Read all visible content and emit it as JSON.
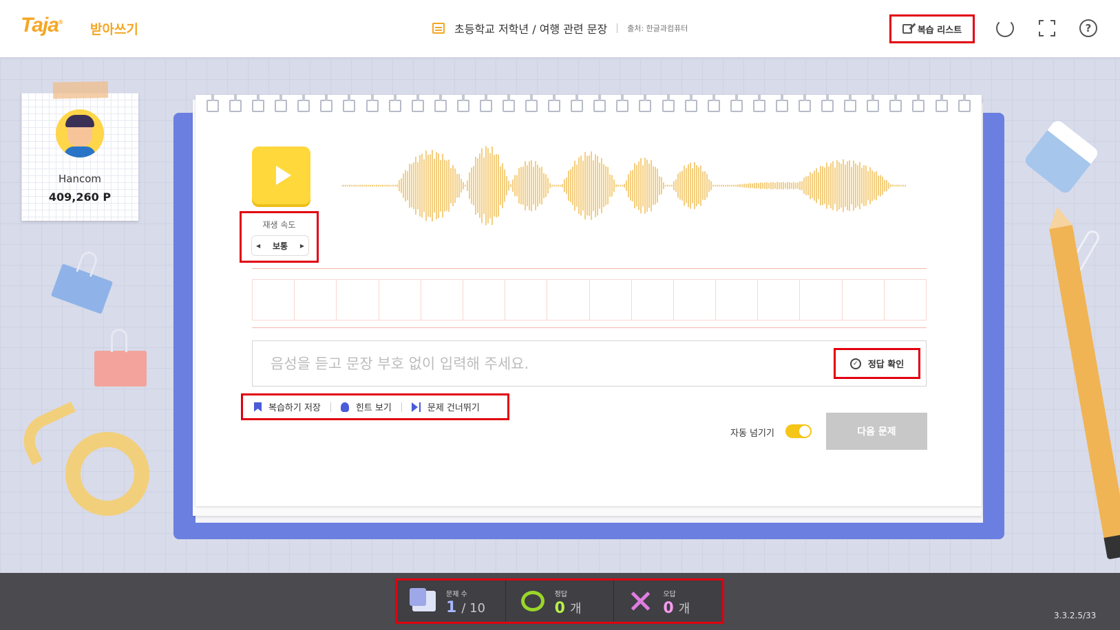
{
  "header": {
    "logo": "Taja",
    "mode_label": "받아쓰기",
    "title": "초등학교 저학년 / 여행 관련 문장",
    "source": "출처: 한글과컴퓨터",
    "review_list_label": "복습 리스트",
    "icons": [
      "list-icon",
      "edit-icon",
      "refresh-icon",
      "fullscreen-icon",
      "help-icon"
    ]
  },
  "profile": {
    "name": "Hancom",
    "points": "409,260 P"
  },
  "player": {
    "speed_label": "재생 속도",
    "speed_value": "보통"
  },
  "answer": {
    "placeholder": "음성을 듣고 문장 부호 없이 입력해 주세요.",
    "check_label": "정답 확인"
  },
  "actions": {
    "save_review": "복습하기 저장",
    "hint": "힌트 보기",
    "skip": "문제 건너뛰기"
  },
  "auto_next": {
    "label": "자동 넘기기",
    "enabled": true
  },
  "next_button": "다음 문제",
  "stats": {
    "questions_label": "문제 수",
    "current": "1",
    "total": "/ 10",
    "correct_label": "정답",
    "correct_count": "0",
    "wrong_label": "오답",
    "wrong_count": "0",
    "unit": "개"
  },
  "version": "3.3.2.5/33",
  "colors": {
    "accent": "#f5a623",
    "highlight": "#e1000f",
    "notebook": "#6b7fe0",
    "play": "#ffd83b"
  }
}
